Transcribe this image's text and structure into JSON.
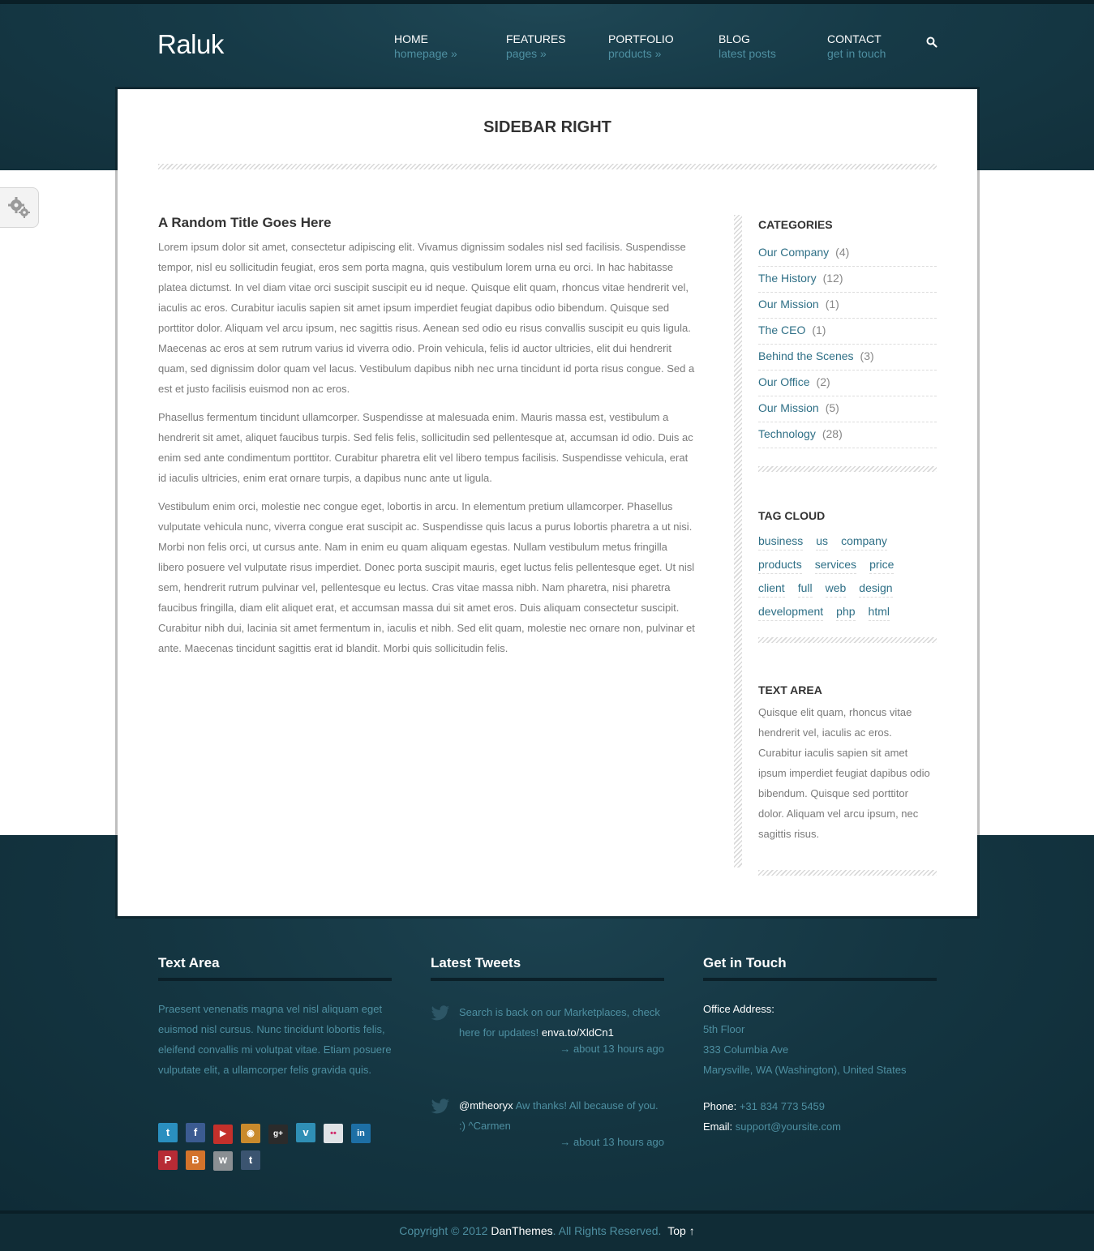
{
  "brand": {
    "logo": "Raluk"
  },
  "nav": [
    {
      "title": "HOME",
      "sub": "homepage »"
    },
    {
      "title": "FEATURES",
      "sub": "pages »"
    },
    {
      "title": "PORTFOLIO",
      "sub": "products »"
    },
    {
      "title": "BLOG",
      "sub": "latest posts"
    },
    {
      "title": "CONTACT",
      "sub": "get in touch"
    }
  ],
  "page": {
    "title": "SIDEBAR RIGHT"
  },
  "article": {
    "title": "A Random Title Goes Here",
    "paragraphs": [
      "Lorem ipsum dolor sit amet, consectetur adipiscing elit. Vivamus dignissim sodales nisl sed facilisis. Suspendisse tempor, nisl eu sollicitudin feugiat, eros sem porta magna, quis vestibulum lorem urna eu orci. In hac habitasse platea dictumst. In vel diam vitae orci suscipit suscipit eu id neque. Quisque elit quam, rhoncus vitae hendrerit vel, iaculis ac eros. Curabitur iaculis sapien sit amet ipsum imperdiet feugiat dapibus odio bibendum. Quisque sed porttitor dolor. Aliquam vel arcu ipsum, nec sagittis risus. Aenean sed odio eu risus convallis suscipit eu quis ligula. Maecenas ac eros at sem rutrum varius id viverra odio. Proin vehicula, felis id auctor ultricies, elit dui hendrerit quam, sed dignissim dolor quam vel lacus. Vestibulum dapibus nibh nec urna tincidunt id porta risus congue. Sed a est et justo facilisis euismod non ac eros.",
      "Phasellus fermentum tincidunt ullamcorper. Suspendisse at malesuada enim. Mauris massa est, vestibulum a hendrerit sit amet, aliquet faucibus turpis. Sed felis felis, sollicitudin sed pellentesque at, accumsan id odio. Duis ac enim sed ante condimentum porttitor. Curabitur pharetra elit vel libero tempus facilisis. Suspendisse vehicula, erat id iaculis ultricies, enim erat ornare turpis, a dapibus nunc ante ut ligula.",
      "Vestibulum enim orci, molestie nec congue eget, lobortis in arcu. In elementum pretium ullamcorper. Phasellus vulputate vehicula nunc, viverra congue erat suscipit ac. Suspendisse quis lacus a purus lobortis pharetra a ut nisi. Morbi non felis orci, ut cursus ante. Nam in enim eu quam aliquam egestas. Nullam vestibulum metus fringilla libero posuere vel vulputate risus imperdiet. Donec porta suscipit mauris, eget luctus felis pellentesque eget. Ut nisl sem, hendrerit rutrum pulvinar vel, pellentesque eu lectus. Cras vitae massa nibh. Nam pharetra, nisi pharetra faucibus fringilla, diam elit aliquet erat, et accumsan massa dui sit amet eros. Duis aliquam consectetur suscipit. Curabitur nibh dui, lacinia sit amet fermentum in, iaculis et nibh. Sed elit quam, molestie nec ornare non, pulvinar et ante. Maecenas tincidunt sagittis erat id blandit. Morbi quis sollicitudin felis."
    ]
  },
  "sidebar": {
    "categories_title": "CATEGORIES",
    "categories": [
      {
        "name": "Our Company",
        "count": "(4)"
      },
      {
        "name": "The History",
        "count": "(12)"
      },
      {
        "name": "Our Mission",
        "count": "(1)"
      },
      {
        "name": "The CEO",
        "count": "(1)"
      },
      {
        "name": "Behind the Scenes",
        "count": "(3)"
      },
      {
        "name": "Our Office",
        "count": "(2)"
      },
      {
        "name": "Our Mission",
        "count": "(5)"
      },
      {
        "name": "Technology",
        "count": "(28)"
      }
    ],
    "tagcloud_title": "TAG CLOUD",
    "tags": [
      "business",
      "us",
      "company",
      "products",
      "services",
      "price",
      "client",
      "full",
      "web",
      "design",
      "development",
      "php",
      "html"
    ],
    "textarea_title": "TEXT AREA",
    "textarea_body": "Quisque elit quam, rhoncus vitae hendrerit vel, iaculis ac eros. Curabitur iaculis sapien sit amet ipsum imperdiet feugiat dapibus odio bibendum. Quisque sed porttitor dolor. Aliquam vel arcu ipsum, nec sagittis risus."
  },
  "footer": {
    "textarea_title": "Text Area",
    "textarea_body": "Praesent venenatis magna vel nisl aliquam eget euismod nisl cursus. Nunc tincidunt lobortis felis, eleifend convallis mi volutpat vitae. Etiam posuere vulputate elit, a ullamcorper felis gravida quis.",
    "social": [
      {
        "icon": "twitter-icon",
        "glyph": "t",
        "color": "#2a8fbf"
      },
      {
        "icon": "facebook-icon",
        "glyph": "f",
        "color": "#3b5b91"
      },
      {
        "icon": "youtube-icon",
        "glyph": "▶",
        "color": "#c4302b"
      },
      {
        "icon": "rss-icon",
        "glyph": "◉",
        "color": "#c98a2c"
      },
      {
        "icon": "google-plus-icon",
        "glyph": "g+",
        "color": "#2b2b2b"
      },
      {
        "icon": "vimeo-icon",
        "glyph": "v",
        "color": "#2f8fb5"
      },
      {
        "icon": "flickr-icon",
        "glyph": "••",
        "color": "#dfe3e6"
      },
      {
        "icon": "linkedin-icon",
        "glyph": "in",
        "color": "#1d6fa5"
      },
      {
        "icon": "pinterest-icon",
        "glyph": "P",
        "color": "#b72b35"
      },
      {
        "icon": "blogger-icon",
        "glyph": "B",
        "color": "#d3732b"
      },
      {
        "icon": "wordpress-icon",
        "glyph": "W",
        "color": "#8a8f93"
      },
      {
        "icon": "tumblr-icon",
        "glyph": "t",
        "color": "#3b5470"
      }
    ],
    "tweets_title": "Latest Tweets",
    "tweets": [
      {
        "text": "Search is back on our Marketplaces, check here for updates!",
        "link": "enva.to/XldCn1",
        "ago": "→ about 13 hours ago"
      },
      {
        "handle": "@mtheoryx",
        "text": "Aw thanks! All because of you. :) ^Carmen",
        "ago": "→ about 13 hours ago"
      }
    ],
    "contact_title": "Get in Touch",
    "contact": {
      "address_label": "Office Address:",
      "address_lines": [
        "5th Floor",
        "333 Columbia Ave",
        "Marysville, WA (Washington), United States"
      ],
      "phone_label": "Phone:",
      "phone": "+31 834 773 5459",
      "email_label": "Email:",
      "email": "support@yoursite.com"
    }
  },
  "copyright": {
    "prefix": "Copyright © 2012",
    "brand": "DanThemes",
    "suffix": ". All Rights Reserved.",
    "top": "Top ↑"
  },
  "colors": {
    "accent": "#2e6f86",
    "footer_link": "#4e8fa1",
    "dark_bg": "#12303b"
  }
}
